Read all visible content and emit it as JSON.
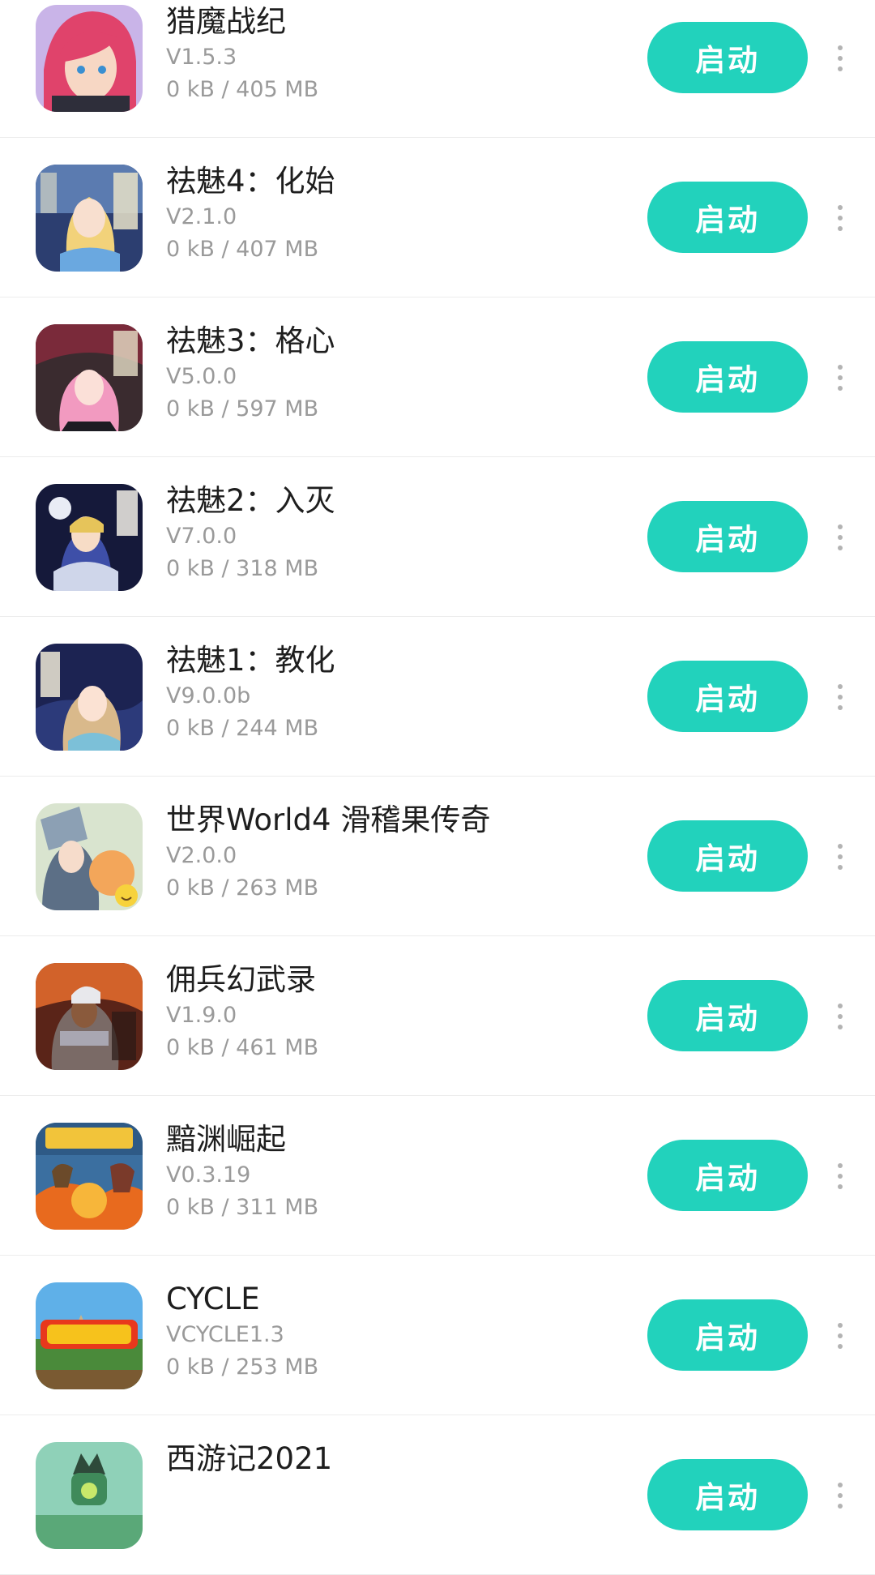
{
  "launch_label": "启动",
  "accent_color": "#22d2bc",
  "apps": [
    {
      "name": "猎魔战纪",
      "version": "V1.5.3",
      "size": "0 kB / 405 MB",
      "icon": "anime-girl-red-hair-icon"
    },
    {
      "name": "祛魅4：化始",
      "version": "V2.1.0",
      "size": "0 kB / 407 MB",
      "icon": "qumei4-game-icon"
    },
    {
      "name": "祛魅3：格心",
      "version": "V5.0.0",
      "size": "0 kB / 597 MB",
      "icon": "qumei3-game-icon"
    },
    {
      "name": "祛魅2：入灭",
      "version": "V7.0.0",
      "size": "0 kB / 318 MB",
      "icon": "qumei2-game-icon"
    },
    {
      "name": "祛魅1：教化",
      "version": "V9.0.0b",
      "size": "0 kB / 244 MB",
      "icon": "qumei1-game-icon"
    },
    {
      "name": "世界World4 滑稽果传奇",
      "version": "V2.0.0",
      "size": "0 kB / 263 MB",
      "icon": "world4-game-icon"
    },
    {
      "name": "佣兵幻武录",
      "version": "V1.9.0",
      "size": "0 kB / 461 MB",
      "icon": "mercenary-game-icon"
    },
    {
      "name": "黯渊崛起",
      "version": "V0.3.19",
      "size": "0 kB / 311 MB",
      "icon": "abyss-rising-game-icon"
    },
    {
      "name": "CYCLE",
      "version": "VCYCLE1.3",
      "size": "0 kB / 253 MB",
      "icon": "cycle-game-icon"
    },
    {
      "name": "西游记2021",
      "version": "",
      "size": "",
      "icon": "journey-west-game-icon"
    }
  ]
}
